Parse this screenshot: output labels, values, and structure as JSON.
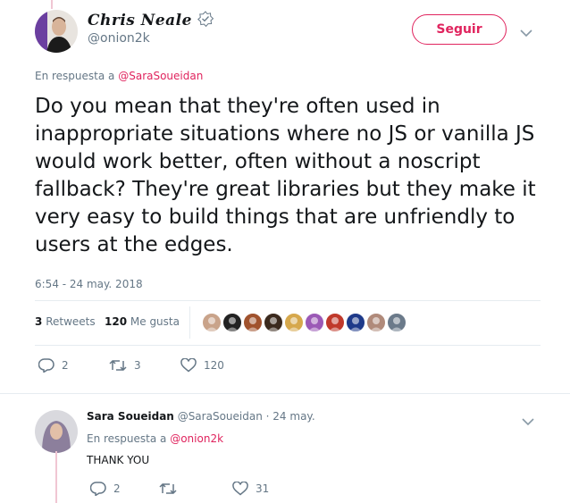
{
  "tweet": {
    "author_name": "Chris Neale",
    "author_handle": "@onion2k",
    "follow_label": "Seguir",
    "reply_prefix": "En respuesta a",
    "reply_to": "@SaraSoueidan",
    "text": "Do you mean that they're often used in inappropriate situations where no JS or vanilla JS would work better, often without a noscript fallback? They're great libraries but they make it very easy to build things that are unfriendly to users at the edges.",
    "timestamp": "6:54 - 24 may. 2018",
    "retweets_count": "3",
    "retweets_label": "Retweets",
    "likes_count": "120",
    "likes_label": "Me gusta",
    "actions": {
      "replies": "2",
      "retweets": "3",
      "likes": "120"
    },
    "likers": [
      {
        "color": "#c9a38a"
      },
      {
        "color": "#222222"
      },
      {
        "color": "#a0522d"
      },
      {
        "color": "#3b2a1e"
      },
      {
        "color": "#d6a84c"
      },
      {
        "color": "#9b59b6"
      },
      {
        "color": "#c0392b"
      },
      {
        "color": "#1e3a8a"
      },
      {
        "color": "#b08a7a"
      },
      {
        "color": "#6b7a8a"
      }
    ]
  },
  "reply": {
    "author_name": "Sara Soueidan",
    "author_handle": "@SaraSoueidan",
    "separator": "·",
    "date": "24 may.",
    "reply_prefix": "En respuesta a",
    "reply_to": "@onion2k",
    "text": "THANK YOU",
    "actions": {
      "replies": "2",
      "likes": "31"
    }
  },
  "colors": {
    "accent": "#e0245e",
    "muted": "#657786",
    "thread": "#f0c6d3",
    "divider": "#e6ecf0"
  },
  "icons": [
    "verified-badge-icon",
    "chevron-down-icon",
    "reply-icon",
    "retweet-icon",
    "like-icon"
  ]
}
